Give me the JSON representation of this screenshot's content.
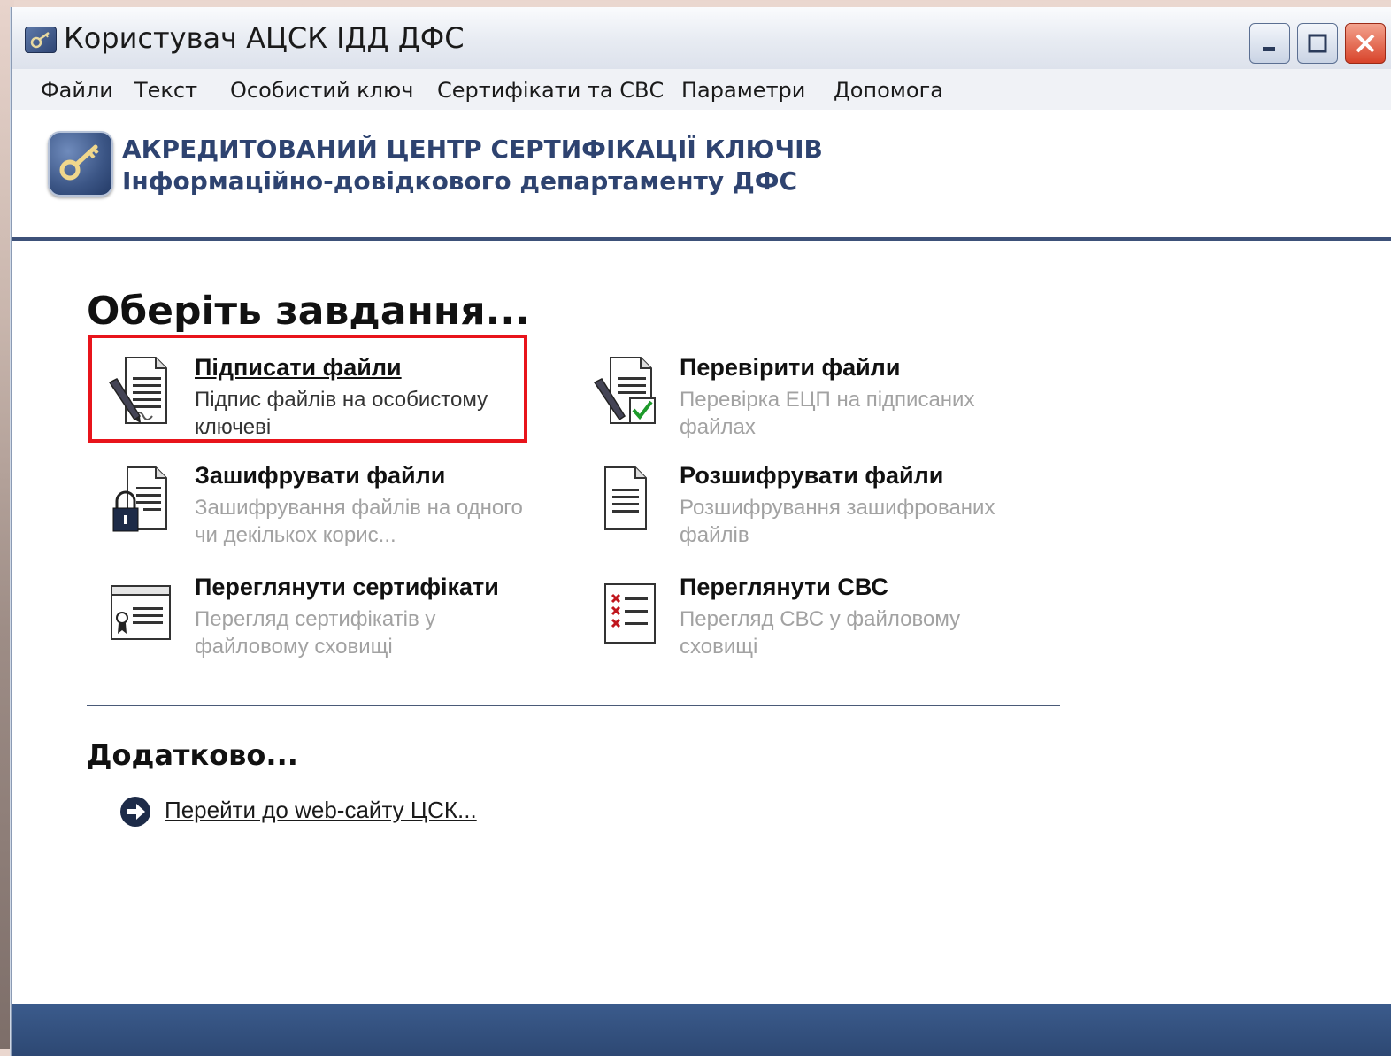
{
  "window": {
    "title": "Користувач АЦСК ІДД ДФС"
  },
  "menu": [
    {
      "label": "Файли"
    },
    {
      "label": "Текст"
    },
    {
      "label": "Особистий ключ"
    },
    {
      "label": "Сертифікати та СВС"
    },
    {
      "label": "Параметри"
    },
    {
      "label": "Допомога"
    }
  ],
  "header": {
    "line1": "АКРЕДИТОВАНИЙ ЦЕНТР СЕРТИФІКАЦІЇ КЛЮЧІВ",
    "line2": "Інформаційно-довідкового департаменту ДФС"
  },
  "main": {
    "heading": "Оберіть завдання...",
    "tasks": [
      {
        "title": "Підписати файли",
        "desc": "Підпис файлів на особистому ключеві",
        "icon": "sign-document-icon"
      },
      {
        "title": "Перевірити файли",
        "desc": "Перевірка ЕЦП на підписаних файлах",
        "icon": "verify-document-icon"
      },
      {
        "title": "Зашифрувати файли",
        "desc": "Зашифрування файлів на одного чи декількох корис...",
        "icon": "encrypt-document-icon"
      },
      {
        "title": "Розшифрувати файли",
        "desc": "Розшифрування зашифрованих файлів",
        "icon": "decrypt-document-icon"
      },
      {
        "title": "Переглянути сертифікати",
        "desc": "Перегляд сертифікатів у файловому сховищі",
        "icon": "certificate-icon"
      },
      {
        "title": "Переглянути СВС",
        "desc": "Перегляд СВС у файловому сховищі",
        "icon": "revocation-list-icon"
      }
    ],
    "selected_task": "Підписати файли",
    "additional_heading": "Додатково...",
    "link": "Перейти до web-сайту ЦСК..."
  },
  "colors": {
    "accent": "#3d5179",
    "highlight": "#e8141b"
  }
}
